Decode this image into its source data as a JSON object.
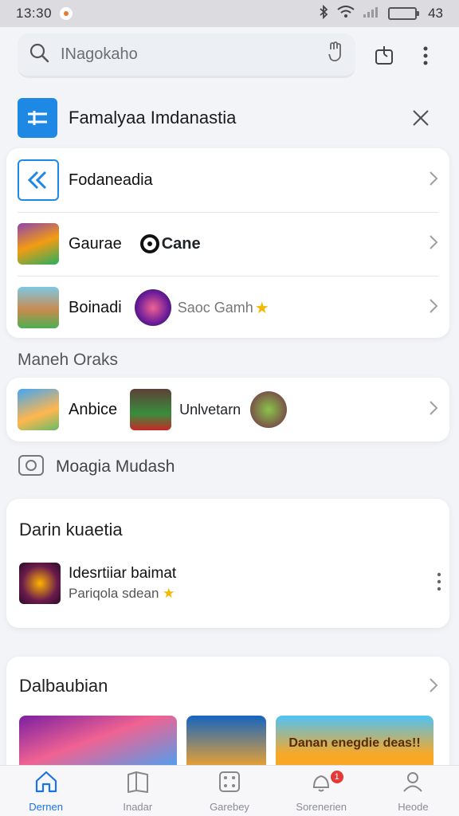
{
  "status_bar": {
    "time": "13:30",
    "battery_text": "43"
  },
  "search": {
    "placeholder": "INagokaho"
  },
  "banner": {
    "title": "Famalyaa Imdanastia"
  },
  "list1": {
    "rows": [
      {
        "label": "Fodaneadia",
        "extra_label": ""
      },
      {
        "label": "Gaurae",
        "extra_label": "Cane"
      },
      {
        "label": "Boinadi",
        "extra_label": "Saoc Gamh"
      }
    ]
  },
  "section2": {
    "title": "Maneh Oraks"
  },
  "list2": {
    "label1": "Anbice",
    "label2": "Unlvetarn"
  },
  "section3": {
    "label": "Moagia Mudash"
  },
  "card3": {
    "heading": "Darin kuaetia",
    "item_title": "Idesrtiiar baimat",
    "item_subtitle": "Pariqola sdean"
  },
  "card4": {
    "heading": "Dalbaubian",
    "tile3_text": "Danan enegdie deas!!"
  },
  "bottom_nav": [
    {
      "label": "Dernen",
      "icon": "home-icon",
      "active": true
    },
    {
      "label": "Inadar",
      "icon": "book-icon",
      "active": false
    },
    {
      "label": "Garebey",
      "icon": "dice-icon",
      "active": false
    },
    {
      "label": "Sorenerien",
      "icon": "bell-icon",
      "active": false,
      "badge": "1"
    },
    {
      "label": "Heode",
      "icon": "person-icon",
      "active": false
    }
  ],
  "colors": {
    "accent": "#1a73e8",
    "brand_blue": "#1e88e5",
    "badge_red": "#e53935",
    "battery": "#d7ea2a"
  }
}
